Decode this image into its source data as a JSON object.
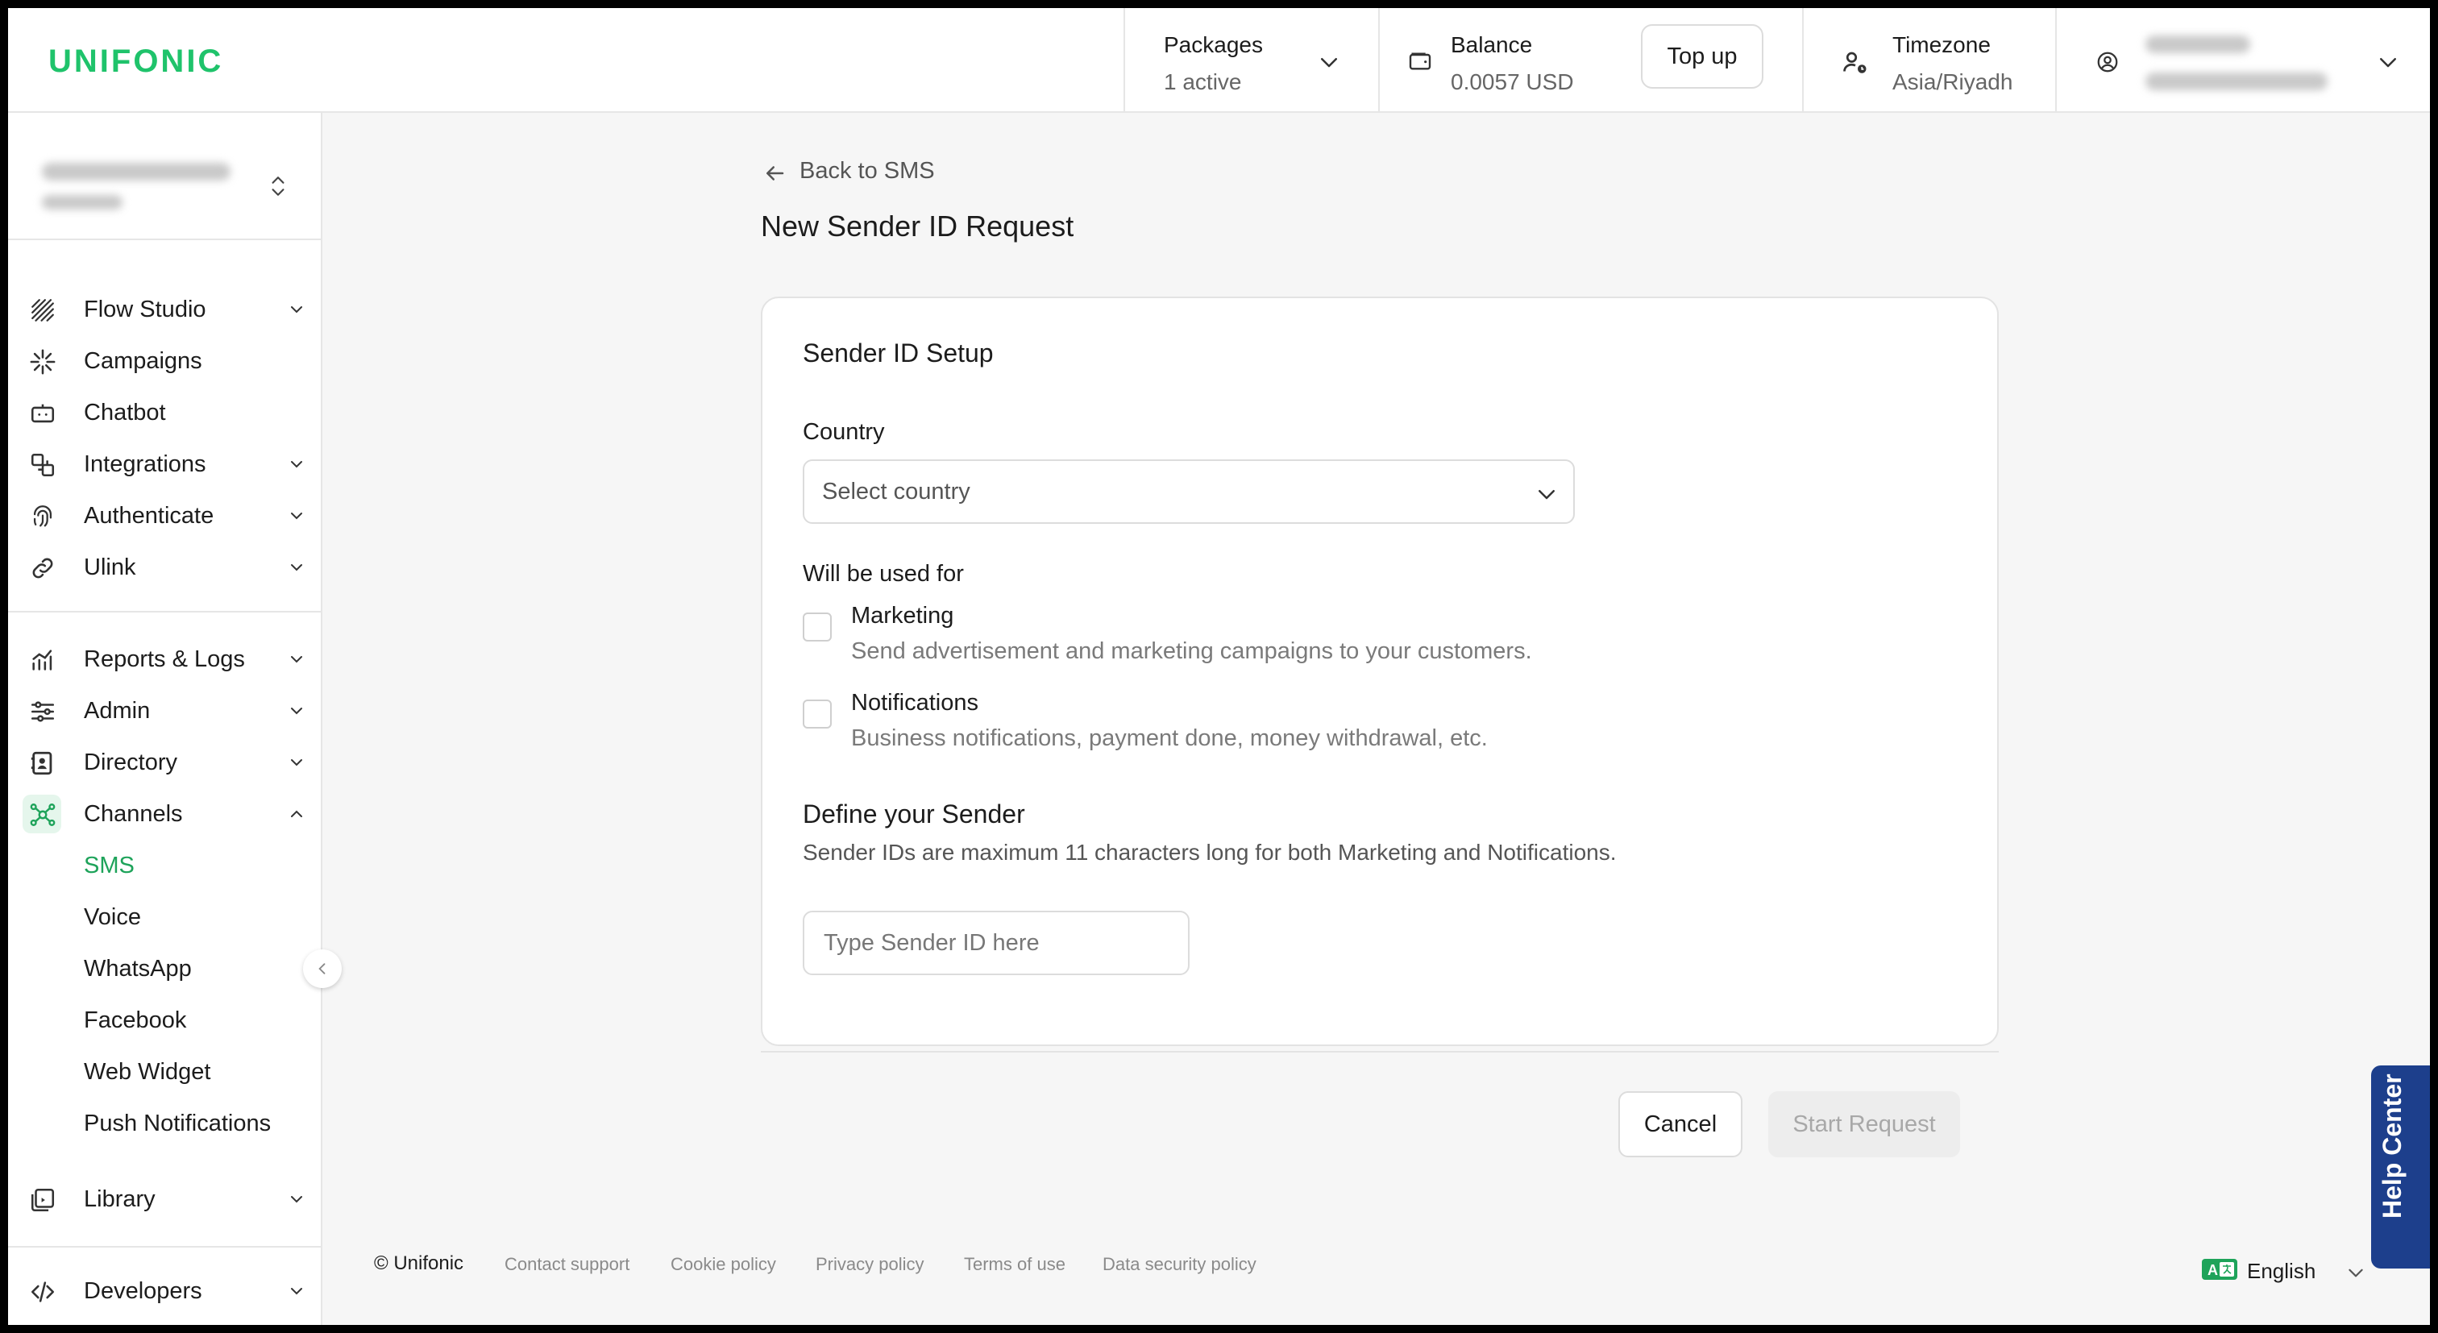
{
  "header": {
    "logo": "UNIFONIC",
    "packages": {
      "label": "Packages",
      "value": "1 active"
    },
    "balance": {
      "label": "Balance",
      "value": "0.0057 USD",
      "topup_label": "Top up"
    },
    "timezone": {
      "label": "Timezone",
      "value": "Asia/Riyadh"
    }
  },
  "sidebar": {
    "items": [
      {
        "label": "Flow Studio",
        "icon": "flow-studio-icon"
      },
      {
        "label": "Campaigns",
        "icon": "campaigns-icon"
      },
      {
        "label": "Chatbot",
        "icon": "chatbot-icon"
      },
      {
        "label": "Integrations",
        "icon": "integrations-icon"
      },
      {
        "label": "Authenticate",
        "icon": "fingerprint-icon"
      },
      {
        "label": "Ulink",
        "icon": "link-icon"
      },
      {
        "label": "Reports & Logs",
        "icon": "reports-icon"
      },
      {
        "label": "Admin",
        "icon": "sliders-icon"
      },
      {
        "label": "Directory",
        "icon": "directory-icon"
      },
      {
        "label": "Channels",
        "icon": "channels-icon"
      },
      {
        "label": "Library",
        "icon": "library-icon"
      },
      {
        "label": "Developers",
        "icon": "code-icon"
      }
    ],
    "channels_sub": [
      "SMS",
      "Voice",
      "WhatsApp",
      "Facebook",
      "Web Widget",
      "Push Notifications"
    ],
    "active_sub": "SMS",
    "accent_color": "#1ea35a"
  },
  "main": {
    "back_label": "Back to SMS",
    "page_title": "New Sender ID Request",
    "card": {
      "title": "Sender ID Setup",
      "country_label": "Country",
      "country_placeholder": "Select country",
      "used_for_label": "Will be used for",
      "options": [
        {
          "label": "Marketing",
          "desc": "Send advertisement and marketing campaigns to your customers.",
          "checked": false
        },
        {
          "label": "Notifications",
          "desc": "Business notifications, payment done, money withdrawal, etc.",
          "checked": false
        }
      ],
      "define_title": "Define your Sender",
      "define_desc": "Sender IDs are maximum 11 characters long for both Marketing and Notifications.",
      "sender_placeholder": "Type Sender ID here",
      "cancel_label": "Cancel",
      "start_label": "Start Request"
    }
  },
  "footer": {
    "copyright": "© Unifonic",
    "links": [
      "Contact support",
      "Cookie policy",
      "Privacy policy",
      "Terms of use",
      "Data security policy"
    ],
    "language": "English",
    "help_label": "Help Center"
  }
}
